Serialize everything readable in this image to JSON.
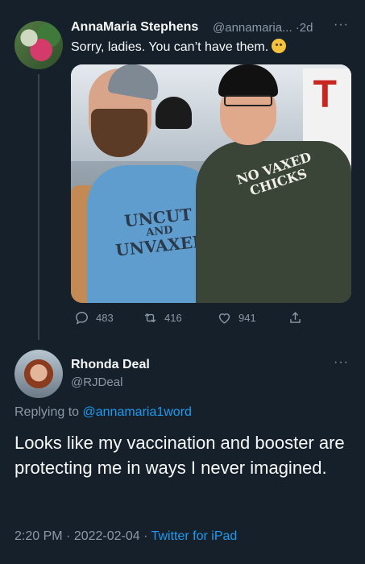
{
  "tweet1": {
    "author_name": "AnnaMaria Stephens",
    "handle": "@annamaria...",
    "separator": "·",
    "age": "2d",
    "more": "···",
    "text": "Sorry, ladies. You can’t have them.",
    "emoji_icon": "disappointed-face-icon",
    "image_text": {
      "left_shirt_line1": "UNCUT",
      "left_shirt_line2": "AND",
      "left_shirt_line3": "UNVAXED",
      "right_shirt_line1": "NO VAXED",
      "right_shirt_line2": "CHICKS",
      "sign_glyph": "T"
    },
    "actions": {
      "replies": "483",
      "retweets": "416",
      "likes": "941"
    }
  },
  "tweet2": {
    "author_name": "Rhonda Deal",
    "handle": "@RJDeal",
    "more": "···",
    "replying_prefix": "Replying to",
    "replying_handle": "@annamaria1word",
    "text": "Looks like my vaccination and booster are protecting me in ways I never imagined.",
    "time": "2:20 PM",
    "date": "2022-02-04",
    "source": "Twitter for iPad",
    "meta_sep": "·"
  },
  "colors": {
    "background": "#15202b",
    "text": "#f7f9f9",
    "muted": "#8b98a5",
    "link": "#1d9bf0"
  }
}
